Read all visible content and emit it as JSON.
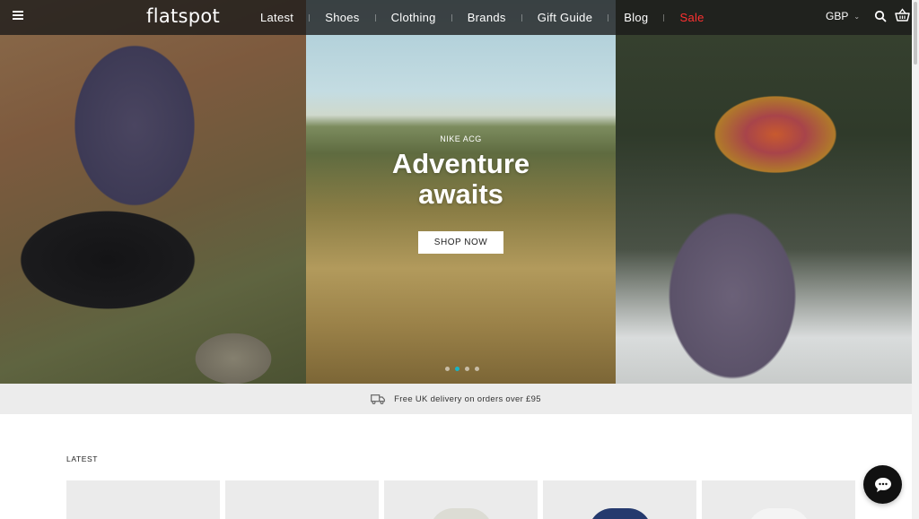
{
  "header": {
    "logo": "flatspot",
    "nav": [
      {
        "label": "Latest"
      },
      {
        "label": "Shoes"
      },
      {
        "label": "Clothing"
      },
      {
        "label": "Brands"
      },
      {
        "label": "Gift Guide"
      },
      {
        "label": "Blog"
      },
      {
        "label": "Sale"
      }
    ],
    "currency": "GBP",
    "sale_color": "#ff3131"
  },
  "hero": {
    "eyebrow": "NIKE ACG",
    "title_line1": "Adventure",
    "title_line2": "awaits",
    "cta": "SHOP NOW",
    "slide_count": 4,
    "active_slide": 2,
    "accent_color": "#18b3c5"
  },
  "delivery": {
    "icon": "truck-icon",
    "text": "Free UK delivery on orders over £95"
  },
  "latest": {
    "title": "LATEST",
    "product_count": 5
  }
}
